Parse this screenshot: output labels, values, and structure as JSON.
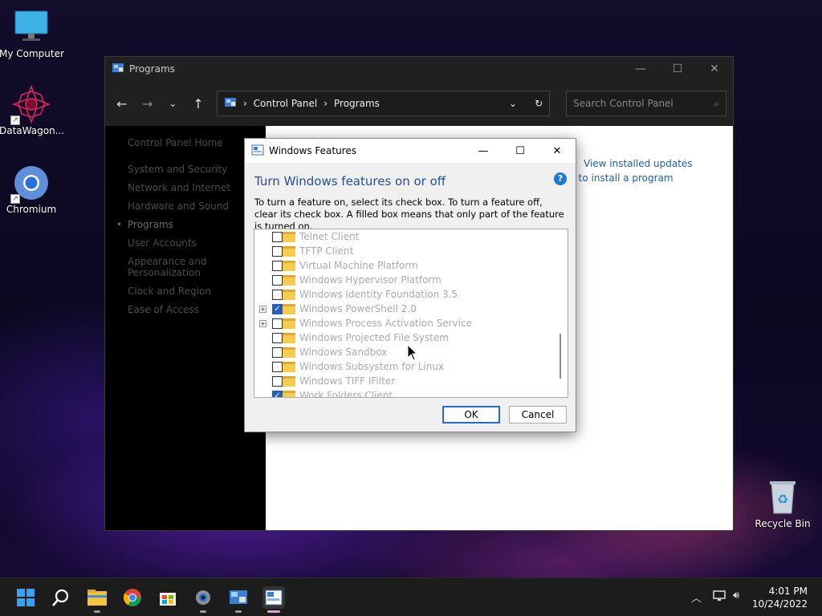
{
  "desktop": {
    "icons": [
      {
        "label": "My Computer"
      },
      {
        "label": "DataWagon..."
      },
      {
        "label": "Chromium"
      },
      {
        "label": "Recycle Bin"
      }
    ]
  },
  "control_panel": {
    "title": "Programs",
    "breadcrumb": [
      "Control Panel",
      "Programs"
    ],
    "search_placeholder": "Search Control Panel",
    "sidebar": [
      "Control Panel Home",
      "System and Security",
      "Network and Internet",
      "Hardware and Sound",
      "Programs",
      "User Accounts",
      "Appearance and Personalization",
      "Clock and Region",
      "Ease of Access"
    ],
    "links": {
      "view_updates": "View installed updates",
      "install_program": "w to install a program"
    }
  },
  "windows_features": {
    "title": "Windows Features",
    "heading": "Turn Windows features on or off",
    "help": "?",
    "description": "To turn a feature on, select its check box. To turn a feature off, clear its check box. A filled box means that only part of the feature is turned on.",
    "features": [
      {
        "name": "Telnet Client",
        "checked": false,
        "expandable": false
      },
      {
        "name": "TFTP Client",
        "checked": false,
        "expandable": false
      },
      {
        "name": "Virtual Machine Platform",
        "checked": false,
        "expandable": false
      },
      {
        "name": "Windows Hypervisor Platform",
        "checked": false,
        "expandable": false
      },
      {
        "name": "Windows Identity Foundation 3.5",
        "checked": false,
        "expandable": false
      },
      {
        "name": "Windows PowerShell 2.0",
        "checked": true,
        "expandable": true
      },
      {
        "name": "Windows Process Activation Service",
        "checked": false,
        "expandable": true
      },
      {
        "name": "Windows Projected File System",
        "checked": false,
        "expandable": false
      },
      {
        "name": "Windows Sandbox",
        "checked": false,
        "expandable": false
      },
      {
        "name": "Windows Subsystem for Linux",
        "checked": false,
        "expandable": false
      },
      {
        "name": "Windows TIFF IFilter",
        "checked": false,
        "expandable": false
      },
      {
        "name": "Work Folders Client",
        "checked": true,
        "expandable": false
      }
    ],
    "ok_label": "OK",
    "cancel_label": "Cancel"
  },
  "taskbar": {
    "time": "4:01 PM",
    "date": "10/24/2022"
  },
  "colors": {
    "accent": "#1e5fbf",
    "link": "#1f5fa8",
    "heading": "#1f4f9a"
  }
}
